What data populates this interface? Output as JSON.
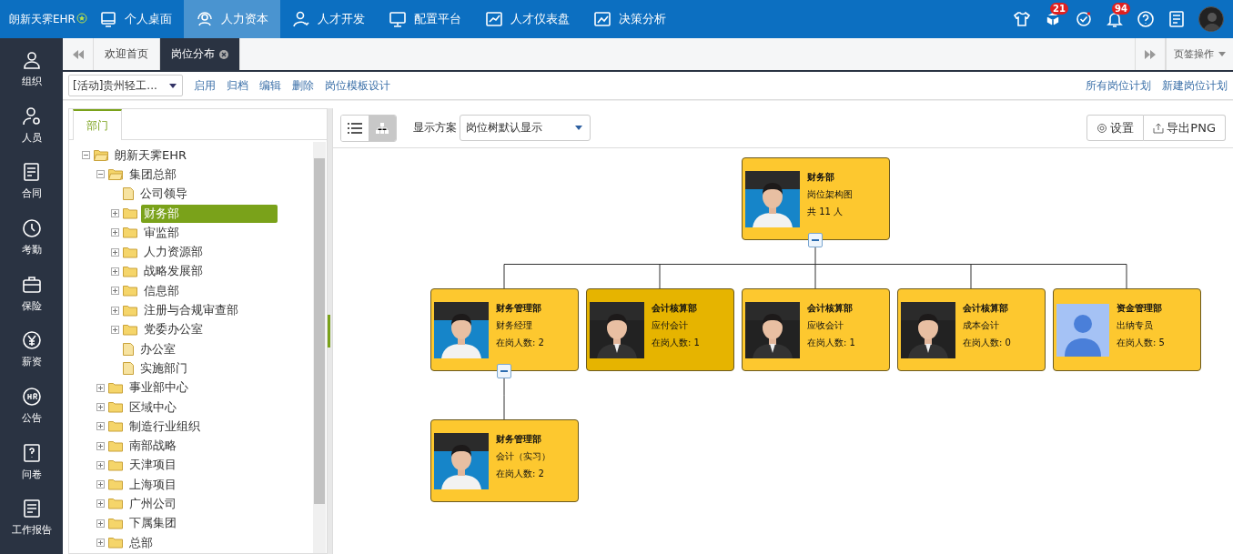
{
  "app": {
    "logo": "朗新天霁EHR"
  },
  "top_nav": [
    {
      "label": "个人桌面",
      "selected": false
    },
    {
      "label": "人力资本",
      "selected": true
    },
    {
      "label": "人才开发",
      "selected": false
    },
    {
      "label": "配置平台",
      "selected": false
    },
    {
      "label": "人才仪表盘",
      "selected": false
    },
    {
      "label": "决策分析",
      "selected": false
    }
  ],
  "top_badges": [
    "21",
    "94"
  ],
  "sidebar": [
    "组织",
    "人员",
    "合同",
    "考勤",
    "保险",
    "薪资",
    "公告",
    "问卷",
    "工作报告"
  ],
  "page_tabs": [
    {
      "label": "欢迎首页",
      "selected": false
    },
    {
      "label": "岗位分布",
      "selected": true
    }
  ],
  "tab_menu": "页签操作",
  "toolbar": {
    "select_value": "[活动]贵州轻工...",
    "actions": [
      "启用",
      "归档",
      "编辑",
      "删除",
      "岗位模板设计"
    ],
    "right_actions": [
      "所有岗位计划",
      "新建岗位计划"
    ]
  },
  "tree_panel": {
    "tab": "部门",
    "tree": [
      {
        "label": "朗新天霁EHR",
        "kind": "folder",
        "expanded": true,
        "selected": false,
        "children": [
          {
            "label": "集团总部",
            "kind": "folder",
            "expanded": true,
            "selected": false,
            "children": [
              {
                "label": "公司领导",
                "kind": "leaf",
                "selected": false
              },
              {
                "label": "财务部",
                "kind": "folder",
                "expanded": false,
                "selected": true
              },
              {
                "label": "审监部",
                "kind": "folder",
                "expanded": false,
                "selected": false
              },
              {
                "label": "人力资源部",
                "kind": "folder",
                "expanded": false,
                "selected": false
              },
              {
                "label": "战略发展部",
                "kind": "folder",
                "expanded": false,
                "selected": false
              },
              {
                "label": "信息部",
                "kind": "folder",
                "expanded": false,
                "selected": false
              },
              {
                "label": "注册与合规审查部",
                "kind": "folder",
                "expanded": false,
                "selected": false
              },
              {
                "label": "党委办公室",
                "kind": "folder",
                "expanded": false,
                "selected": false
              },
              {
                "label": "办公室",
                "kind": "leaf",
                "selected": false
              },
              {
                "label": "实施部门",
                "kind": "leaf",
                "selected": false
              }
            ]
          },
          {
            "label": "事业部中心",
            "kind": "folder",
            "expanded": false,
            "selected": false
          },
          {
            "label": "区域中心",
            "kind": "folder",
            "expanded": false,
            "selected": false
          },
          {
            "label": "制造行业组织",
            "kind": "folder",
            "expanded": false,
            "selected": false
          },
          {
            "label": "南部战略",
            "kind": "folder",
            "expanded": false,
            "selected": false
          },
          {
            "label": "天津项目",
            "kind": "folder",
            "expanded": false,
            "selected": false
          },
          {
            "label": "上海项目",
            "kind": "folder",
            "expanded": false,
            "selected": false
          },
          {
            "label": "广州公司",
            "kind": "folder",
            "expanded": false,
            "selected": false
          },
          {
            "label": "下属集团",
            "kind": "folder",
            "expanded": false,
            "selected": false
          },
          {
            "label": "总部",
            "kind": "folder",
            "expanded": false,
            "selected": false
          }
        ]
      }
    ]
  },
  "chart_panel": {
    "view_modes": [
      {
        "selected": false
      },
      {
        "selected": true
      }
    ],
    "scheme_label": "显示方案",
    "scheme_value": "岗位树默认显示",
    "buttons": [
      "设置",
      "导出PNG"
    ],
    "org_chart": {
      "dept": "财务部",
      "title": "岗位架构图",
      "count": "共 11 人",
      "kind": "picture",
      "expanded": true,
      "highlighted": false,
      "children": [
        {
          "dept": "财务管理部",
          "title": "财务经理",
          "count": "在岗人数: 2",
          "kind": "picture",
          "expanded": true,
          "highlighted": false,
          "children": [
            {
              "dept": "财务管理部",
              "title": "会计（实习）",
              "count": "在岗人数: 2",
              "kind": "picture",
              "highlighted": false
            }
          ]
        },
        {
          "dept": "会计核算部",
          "title": "应付会计",
          "count": "在岗人数: 1",
          "kind": "picture",
          "highlighted": true
        },
        {
          "dept": "会计核算部",
          "title": "应收会计",
          "count": "在岗人数: 1",
          "kind": "picture",
          "highlighted": false
        },
        {
          "dept": "会计核算部",
          "title": "成本会计",
          "count": "在岗人数: 0",
          "kind": "picture",
          "highlighted": false
        },
        {
          "dept": "资金管理部",
          "title": "出纳专员",
          "count": "在岗人数: 5",
          "kind": "avatar",
          "highlighted": false
        }
      ]
    }
  }
}
